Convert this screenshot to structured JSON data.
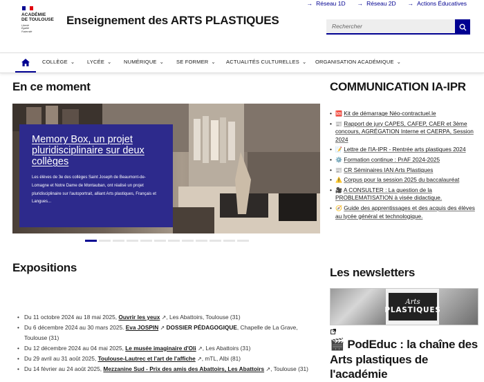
{
  "logo": {
    "line1": "ACADÉMIE",
    "line2": "DE TOULOUSE",
    "motto": [
      "Liberté",
      "Égalité",
      "Fraternité"
    ]
  },
  "site_title": "Enseignement des ARTS PLASTIQUES",
  "top_links": [
    "Réseau 1D",
    "Réseau 2D",
    "Actions Éducatives"
  ],
  "search": {
    "placeholder": "Rechercher"
  },
  "nav": {
    "home_icon": "home-icon",
    "items": [
      "COLLÈGE",
      "LYCÉE",
      "NUMÉRIQUE",
      "SE FORMER",
      "ACTUALITÉS CULTURELLES",
      "ORGANISATION ACADÉMIQUE"
    ]
  },
  "en_ce_moment": {
    "heading": "En ce moment",
    "slide": {
      "title": "Memory Box, un projet pluridisciplinaire sur deux collèges",
      "description": "Les élèves de 3e des collèges Saint Joseph de Beaumont-de-Lomagne et Notre Dame de Montauban, ont réalisé un projet pluridisciplinaire sur l'autoportrait, alliant Arts plastiques, Français et Langues..."
    },
    "slide_count": 12,
    "active_slide": 1
  },
  "expositions": {
    "heading": "Expositions",
    "items": [
      {
        "date": "Du 11 octobre 2024 au 18 mai 2025,",
        "link": "Ouvrir les yeux",
        "extra": "",
        "place": ", Les Abattoirs, Toulouse (31)"
      },
      {
        "date": "Du 6 décembre 2024 au 30 mars 2025.",
        "link": "Eva JOSPIN",
        "extra": "DOSSIER PÉDAGOGIQUE",
        "place": ", Chapelle de La Grave, Toulouse (31)"
      },
      {
        "date": "Du 12 décembre 2024 au 04 mai 2025,",
        "link": "Le musée imaginaire d'Oli",
        "extra": "",
        "place": ", Les Abattoirs (31)"
      },
      {
        "date": "Du 29 avril au 31 août 2025,",
        "link": "Toulouse-Lautrec et l'art de l'affiche",
        "extra": "",
        "place": ", mTL, Albi (81)"
      },
      {
        "date": "Du 14 février au 24 août 2025,",
        "link": "Mezzanine Sud - Prix des amis des Abattoirs, Les Abattoirs",
        "extra": "",
        "place": ", Toulouse (31)"
      }
    ]
  },
  "communication": {
    "heading": "COMMUNICATION IA-IPR",
    "items": [
      {
        "emoji": "🆘",
        "text": "Kit de démarrage Néo-contractuel.le"
      },
      {
        "emoji": "📰",
        "text": "Rapport de jury CAPES, CAFEP, CAER et 3ème concours, AGRÉGATION Interne et CAERPA, Session 2024"
      },
      {
        "emoji": "📝",
        "text": "Lettre de l'IA-IPR - Rentrée arts plastiques 2024"
      },
      {
        "emoji": "⚙️",
        "text": "Formation continue : PrAF 2024-2025"
      },
      {
        "emoji": "📰",
        "text": "CR Séminaires IAN Arts Plastiques"
      },
      {
        "emoji": "⚠️",
        "text": "Corpus pour la session 2025 du baccalauréat"
      },
      {
        "emoji": "🎥",
        "text": "A CONSULTER : La question de la PROBLEMATISATION à visée didactique."
      },
      {
        "emoji": "🧭",
        "text": "Guide des apprentissages et des acquis des élèves au lycée général et technologique."
      }
    ]
  },
  "newsletters": {
    "heading": "Les newsletters",
    "banner_line1": "Arts",
    "banner_line2": "PLASTIQUES",
    "podeduc_emoji": "🎬",
    "podeduc": "PodEduc : la chaîne des Arts plastiques de l'académie"
  },
  "colors": {
    "accent": "#000091",
    "card": "#2d2a8c",
    "marianne_red": "#e1000f"
  }
}
